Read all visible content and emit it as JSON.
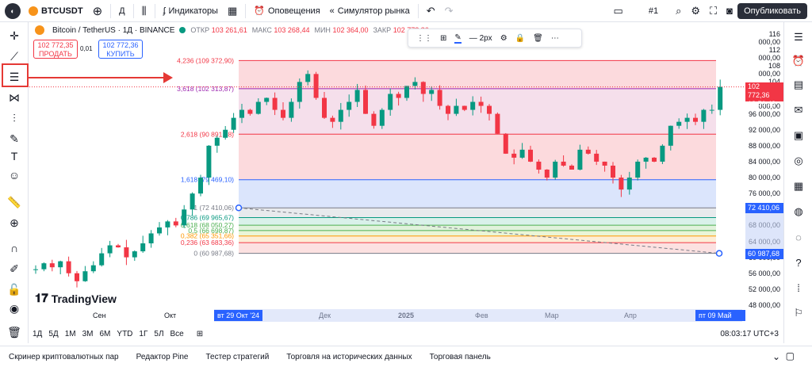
{
  "topbar": {
    "symbol": "BTCUSDT",
    "interval": "Д",
    "indicators": "Индикаторы",
    "alerts": "Оповещения",
    "replay": "Симулятор рынка",
    "layout_num": "#1",
    "publish": "Опубликовать"
  },
  "legend": {
    "title": "Bitcoin / TetherUS · 1Д · BINANCE",
    "open_label": "ОТКР",
    "open": "103 261,61",
    "high_label": "МАКС",
    "high": "103 268,44",
    "low_label": "МИН",
    "low": "102 364,00",
    "close_label": "ЗАКР",
    "close": "102 772,36"
  },
  "trade": {
    "sell_price": "102 772,35",
    "sell_label": "ПРОДАТЬ",
    "spread": "0,01",
    "buy_price": "102 772,36",
    "buy_label": "КУПИТЬ"
  },
  "drawing_toolbar": {
    "width_label": "2px"
  },
  "fib_levels": [
    {
      "label": "4,236 (109 372,90)",
      "price": 109372.9,
      "color": "#f23645",
      "fill": "#fbd3d7"
    },
    {
      "label": "3,618 (102 313,87)",
      "price": 102313.87,
      "color": "#9c27b0",
      "fill": "#f3d9e7"
    },
    {
      "label": "2,618 (90 891,48)",
      "price": 90891.48,
      "color": "#f23645",
      "fill": "#fbd3d7"
    },
    {
      "label": "1,618 (79 469,10)",
      "price": 79469.1,
      "color": "#2962ff",
      "fill": "#d5e0fb"
    },
    {
      "label": "1 (72 410,06)",
      "price": 72410.06,
      "color": "#787b86",
      "fill": "#e4e6ea"
    },
    {
      "label": "0,786 (69 965,67)",
      "price": 69965.67,
      "color": "#089981",
      "fill": "#d2eee6"
    },
    {
      "label": "0,618 (68 050,27)",
      "price": 68050.27,
      "color": "#4caf50",
      "fill": "#dcf0d6"
    },
    {
      "label": "0,5 (66 698,87)",
      "price": 66698.87,
      "color": "#4caf50",
      "fill": "#e6f3d0"
    },
    {
      "label": "0,382 (65 351,66)",
      "price": 65351.66,
      "color": "#ff9800",
      "fill": "#fdebcf"
    },
    {
      "label": "0,236 (63 683,36)",
      "price": 63683.36,
      "color": "#f23645",
      "fill": "#fbdcdc"
    },
    {
      "label": "0 (60 987,68)",
      "price": 60987.68,
      "color": "#787b86",
      "fill": "#ffffff"
    }
  ],
  "price_axis": {
    "ticks": [
      "116 000,00",
      "112 000,00",
      "108 000,00",
      "104 000,00",
      "100 000,00",
      "96 000,00",
      "92 000,00",
      "88 000,00",
      "84 000,00",
      "80 000,00",
      "76 000,00",
      "72 000,00",
      "68 000,00",
      "64 000,00",
      "60 000,00",
      "56 000,00",
      "52 000,00",
      "48 000,00"
    ],
    "current_price": "102 772,36",
    "countdown": "18:56:43",
    "fib_top_tag": "72 410,06",
    "fib_bottom_tag": "60 987,68"
  },
  "chart_data": {
    "type": "candlestick",
    "symbol": "BTCUSDT",
    "interval": "1D",
    "ylim": [
      46000,
      118000
    ],
    "x_ticks": [
      "Сен",
      "Окт",
      "Дек",
      "2025",
      "Фев",
      "Мар",
      "Апр"
    ],
    "close_path": [
      [
        0,
        57000
      ],
      [
        8,
        58500
      ],
      [
        16,
        57500
      ],
      [
        24,
        59000
      ],
      [
        32,
        56000
      ],
      [
        40,
        54000
      ],
      [
        48,
        56500
      ],
      [
        56,
        58000
      ],
      [
        64,
        61000
      ],
      [
        72,
        63000
      ],
      [
        80,
        62500
      ],
      [
        88,
        60000
      ],
      [
        96,
        61500
      ],
      [
        104,
        63500
      ],
      [
        112,
        66000
      ],
      [
        120,
        67500
      ],
      [
        128,
        69000
      ],
      [
        136,
        68000
      ],
      [
        144,
        72000
      ],
      [
        152,
        76000
      ],
      [
        160,
        80000
      ],
      [
        168,
        88000
      ],
      [
        176,
        90000
      ],
      [
        184,
        92000
      ],
      [
        192,
        95000
      ],
      [
        200,
        97000
      ],
      [
        208,
        96000
      ],
      [
        216,
        99000
      ],
      [
        224,
        100000
      ],
      [
        232,
        97000
      ],
      [
        240,
        95000
      ],
      [
        248,
        99000
      ],
      [
        256,
        104000
      ],
      [
        264,
        106000
      ],
      [
        272,
        100000
      ],
      [
        280,
        95000
      ],
      [
        288,
        94000
      ],
      [
        296,
        97000
      ],
      [
        304,
        99000
      ],
      [
        312,
        102000
      ],
      [
        320,
        96000
      ],
      [
        328,
        93000
      ],
      [
        336,
        97000
      ],
      [
        344,
        101000
      ],
      [
        352,
        100000
      ],
      [
        360,
        103000
      ],
      [
        368,
        104000
      ],
      [
        376,
        101000
      ],
      [
        384,
        102000
      ],
      [
        392,
        98000
      ],
      [
        400,
        96000
      ],
      [
        408,
        98000
      ],
      [
        416,
        97000
      ],
      [
        424,
        99000
      ],
      [
        432,
        98000
      ],
      [
        440,
        96000
      ],
      [
        448,
        91000
      ],
      [
        456,
        86000
      ],
      [
        464,
        85000
      ],
      [
        472,
        87000
      ],
      [
        480,
        84000
      ],
      [
        488,
        82000
      ],
      [
        496,
        80000
      ],
      [
        504,
        84000
      ],
      [
        512,
        83000
      ],
      [
        520,
        82000
      ],
      [
        528,
        87000
      ],
      [
        536,
        86000
      ],
      [
        544,
        84000
      ],
      [
        552,
        83000
      ],
      [
        560,
        80000
      ],
      [
        568,
        77000
      ],
      [
        576,
        80000
      ],
      [
        584,
        84000
      ],
      [
        592,
        85000
      ],
      [
        600,
        84000
      ],
      [
        608,
        88000
      ],
      [
        616,
        93000
      ],
      [
        624,
        94000
      ],
      [
        632,
        95000
      ],
      [
        640,
        94000
      ],
      [
        648,
        97000
      ],
      [
        656,
        97000
      ],
      [
        664,
        102772
      ]
    ]
  },
  "time_axis": {
    "labels": [
      "Сен",
      "Окт",
      "Дек",
      "2025",
      "Фев",
      "Мар",
      "Апр"
    ],
    "start_tag": "вт 29 Окт '24",
    "end_tag": "пт 09 Май '25"
  },
  "periods": [
    "1Д",
    "5Д",
    "1М",
    "3М",
    "6М",
    "YTD",
    "1Г",
    "5Л",
    "Все"
  ],
  "clock": "08:03:17 UTC+3",
  "watermark": "TradingView",
  "bottom_tabs": [
    "Скринер криптовалютных пар",
    "Редактор Pine",
    "Тестер стратегий",
    "Торговля на исторических данных",
    "Торговая панель"
  ]
}
